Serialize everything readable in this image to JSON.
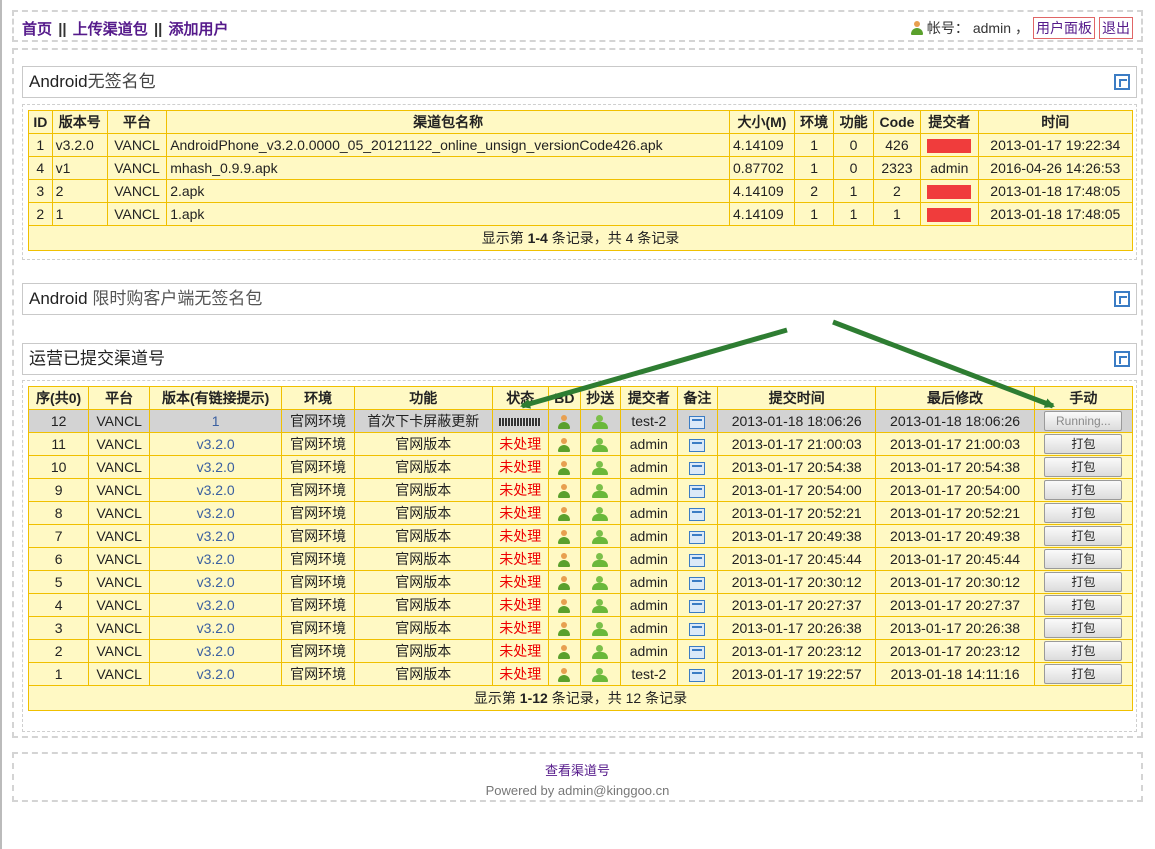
{
  "nav": {
    "home": "首页",
    "upload": "上传渠道包",
    "add_user": "添加用户",
    "sep": "||"
  },
  "account": {
    "label": "帐号：",
    "user": "admin",
    "comma": "，",
    "panel": "用户面板",
    "logout": "退出"
  },
  "panels": {
    "unsigned": {
      "title_prefix": "Android",
      "title_rest": "无签名包"
    },
    "flash": {
      "title_prefix": "Android",
      "title_rest": " 限时购客户端无签名包"
    },
    "submitted": {
      "title": "运营已提交渠道号"
    }
  },
  "table1": {
    "headers": [
      "ID",
      "版本号",
      "平台",
      "渠道包名称",
      "大小(M)",
      "环境",
      "功能",
      "Code",
      "提交者",
      "时间"
    ],
    "rows": [
      {
        "id": "1",
        "ver": "v3.2.0",
        "platform": "VANCL",
        "name": "AndroidPhone_v3.2.0.0000_05_20121122_online_unsign_versionCode426.apk",
        "size": "4.14109",
        "env": "1",
        "func": "0",
        "code": "426",
        "submitter": "",
        "time": "2013-01-17 19:22:34"
      },
      {
        "id": "4",
        "ver": "v1",
        "platform": "VANCL",
        "name": "mhash_0.9.9.apk",
        "size": "0.87702",
        "env": "1",
        "func": "0",
        "code": "2323",
        "submitter": "admin",
        "time": "2016-04-26 14:26:53"
      },
      {
        "id": "3",
        "ver": "2",
        "platform": "VANCL",
        "name": "2.apk",
        "size": "4.14109",
        "env": "2",
        "func": "1",
        "code": "2",
        "submitter": "",
        "time": "2013-01-18 17:48:05"
      },
      {
        "id": "2",
        "ver": "1",
        "platform": "VANCL",
        "name": "1.apk",
        "size": "4.14109",
        "env": "1",
        "func": "1",
        "code": "1",
        "submitter": "",
        "time": "2013-01-18 17:48:05"
      }
    ],
    "footer": {
      "pre": "显示第 ",
      "range": "1-4",
      "post": " 条记录，共 4 条记录"
    }
  },
  "table2": {
    "headers": [
      "序(共0)",
      "平台",
      "版本(有链接提示)",
      "环境",
      "功能",
      "状态",
      "BD",
      "抄送",
      "提交者",
      "备注",
      "提交时间",
      "最后修改",
      "手动"
    ],
    "rows": [
      {
        "no": "12",
        "platform": "VANCL",
        "ver": "1",
        "env": "官网环境",
        "func": "首次下卡屏蔽更新",
        "status": "",
        "submitter": "test-2",
        "submit_time": "2013-01-18 18:06:26",
        "modified": "2013-01-18 18:06:26",
        "action": "Running..."
      },
      {
        "no": "11",
        "platform": "VANCL",
        "ver": "v3.2.0",
        "env": "官网环境",
        "func": "官网版本",
        "status": "未处理",
        "submitter": "admin",
        "submit_time": "2013-01-17 21:00:03",
        "modified": "2013-01-17 21:00:03",
        "action": "打包"
      },
      {
        "no": "10",
        "platform": "VANCL",
        "ver": "v3.2.0",
        "env": "官网环境",
        "func": "官网版本",
        "status": "未处理",
        "submitter": "admin",
        "submit_time": "2013-01-17 20:54:38",
        "modified": "2013-01-17 20:54:38",
        "action": "打包"
      },
      {
        "no": "9",
        "platform": "VANCL",
        "ver": "v3.2.0",
        "env": "官网环境",
        "func": "官网版本",
        "status": "未处理",
        "submitter": "admin",
        "submit_time": "2013-01-17 20:54:00",
        "modified": "2013-01-17 20:54:00",
        "action": "打包"
      },
      {
        "no": "8",
        "platform": "VANCL",
        "ver": "v3.2.0",
        "env": "官网环境",
        "func": "官网版本",
        "status": "未处理",
        "submitter": "admin",
        "submit_time": "2013-01-17 20:52:21",
        "modified": "2013-01-17 20:52:21",
        "action": "打包"
      },
      {
        "no": "7",
        "platform": "VANCL",
        "ver": "v3.2.0",
        "env": "官网环境",
        "func": "官网版本",
        "status": "未处理",
        "submitter": "admin",
        "submit_time": "2013-01-17 20:49:38",
        "modified": "2013-01-17 20:49:38",
        "action": "打包"
      },
      {
        "no": "6",
        "platform": "VANCL",
        "ver": "v3.2.0",
        "env": "官网环境",
        "func": "官网版本",
        "status": "未处理",
        "submitter": "admin",
        "submit_time": "2013-01-17 20:45:44",
        "modified": "2013-01-17 20:45:44",
        "action": "打包"
      },
      {
        "no": "5",
        "platform": "VANCL",
        "ver": "v3.2.0",
        "env": "官网环境",
        "func": "官网版本",
        "status": "未处理",
        "submitter": "admin",
        "submit_time": "2013-01-17 20:30:12",
        "modified": "2013-01-17 20:30:12",
        "action": "打包"
      },
      {
        "no": "4",
        "platform": "VANCL",
        "ver": "v3.2.0",
        "env": "官网环境",
        "func": "官网版本",
        "status": "未处理",
        "submitter": "admin",
        "submit_time": "2013-01-17 20:27:37",
        "modified": "2013-01-17 20:27:37",
        "action": "打包"
      },
      {
        "no": "3",
        "platform": "VANCL",
        "ver": "v3.2.0",
        "env": "官网环境",
        "func": "官网版本",
        "status": "未处理",
        "submitter": "admin",
        "submit_time": "2013-01-17 20:26:38",
        "modified": "2013-01-17 20:26:38",
        "action": "打包"
      },
      {
        "no": "2",
        "platform": "VANCL",
        "ver": "v3.2.0",
        "env": "官网环境",
        "func": "官网版本",
        "status": "未处理",
        "submitter": "admin",
        "submit_time": "2013-01-17 20:23:12",
        "modified": "2013-01-17 20:23:12",
        "action": "打包"
      },
      {
        "no": "1",
        "platform": "VANCL",
        "ver": "v3.2.0",
        "env": "官网环境",
        "func": "官网版本",
        "status": "未处理",
        "submitter": "test-2",
        "submit_time": "2013-01-17 19:22:57",
        "modified": "2013-01-18 14:11:16",
        "action": "打包"
      }
    ],
    "footer": {
      "pre": "显示第 ",
      "range": "1-12",
      "post": " 条记录，共 12 条记录"
    }
  },
  "footer": {
    "link": "查看渠道号",
    "powered": "Powered by admin@kinggoo.cn"
  },
  "colors": {
    "arrow": "#2e7d32",
    "table_bg": "#fff9c4",
    "table_border": "#f0c000",
    "status_red": "#ee0000"
  },
  "icons": [
    "user-icon",
    "panel-toggle-icon",
    "bd-person-icon",
    "cc-people-icon",
    "note-icon",
    "progress-icon"
  ]
}
